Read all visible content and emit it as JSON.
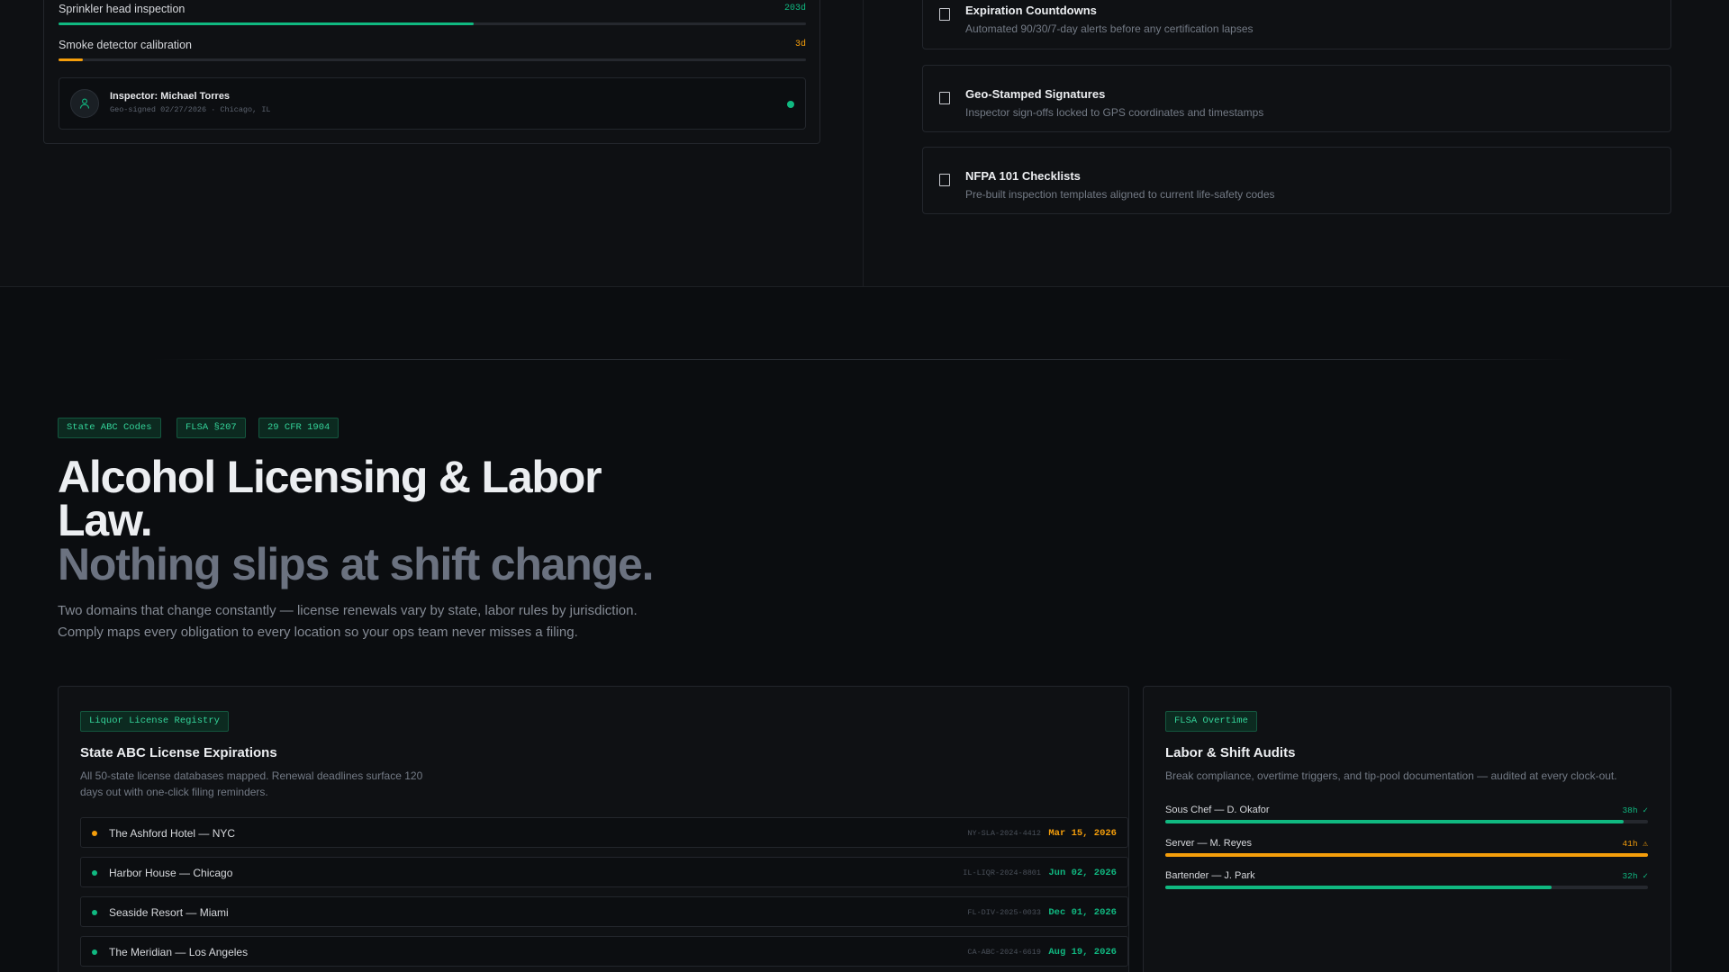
{
  "colors": {
    "green": "#10b981",
    "amber": "#f59e0b",
    "bg": "#0b0d10"
  },
  "inspection": {
    "items": [
      {
        "label": "Sprinkler head inspection",
        "count": "203d",
        "progress": 0.555,
        "color": "#10b981"
      },
      {
        "label": "Smoke detector calibration",
        "count": "3d",
        "progress": 0.033,
        "color": "#f59e0b"
      }
    ],
    "inspector": {
      "name": "Inspector: Michael Torres",
      "meta": "Geo-signed 02/27/2026 · Chicago, IL",
      "icon": "user-icon"
    }
  },
  "features": [
    {
      "title": "Expiration Countdowns",
      "desc": "Automated 90/30/7-day alerts before any certification lapses",
      "icon": "checkbox-icon"
    },
    {
      "title": "Geo-Stamped Signatures",
      "desc": "Inspector sign-offs locked to GPS coordinates and timestamps",
      "icon": "checkbox-icon"
    },
    {
      "title": "NFPA 101 Checklists",
      "desc": "Pre-built inspection templates aligned to current life-safety codes",
      "icon": "checkbox-icon"
    }
  ],
  "section": {
    "tags": [
      "State ABC Codes",
      "FLSA §207",
      "29 CFR 1904"
    ],
    "headline": "Alcohol Licensing & Labor Law.",
    "subheadline": "Nothing slips at shift change.",
    "lede": "Two domains that change constantly — license renewals vary by state, labor rules by jurisdiction. Comply maps every obligation to every location so your ops team never misses a filing."
  },
  "liquor": {
    "tag": "Liquor License Registry",
    "title": "State ABC License Expirations",
    "desc": "All 50-state license databases mapped. Renewal deadlines surface 120 days out with one-click filing reminders.",
    "rows": [
      {
        "name": "The Ashford Hotel — NYC",
        "code": "NY-SLA-2024-4412",
        "date": "Mar 15, 2026",
        "status": "warning"
      },
      {
        "name": "Harbor House — Chicago",
        "code": "IL-LIQR-2024-8801",
        "date": "Jun 02, 2026",
        "status": "ok"
      },
      {
        "name": "Seaside Resort — Miami",
        "code": "FL-DIV-2025-0033",
        "date": "Dec 01, 2026",
        "status": "ok"
      },
      {
        "name": "The Meridian — Los Angeles",
        "code": "CA-ABC-2024-6619",
        "date": "Aug 19, 2026",
        "status": "ok"
      }
    ]
  },
  "labor": {
    "tag": "FLSA Overtime",
    "title": "Labor & Shift Audits",
    "desc": "Break compliance, overtime triggers, and tip-pool documentation — audited at every clock-out.",
    "shifts": [
      {
        "label": "Sous Chef — D. Okafor",
        "hours": "38h ✓",
        "progress": 0.95,
        "status": "ok"
      },
      {
        "label": "Server — M. Reyes",
        "hours": "41h ⚠",
        "progress": 1.0,
        "status": "warning"
      },
      {
        "label": "Bartender — J. Park",
        "hours": "32h ✓",
        "progress": 0.8,
        "status": "ok"
      }
    ]
  }
}
